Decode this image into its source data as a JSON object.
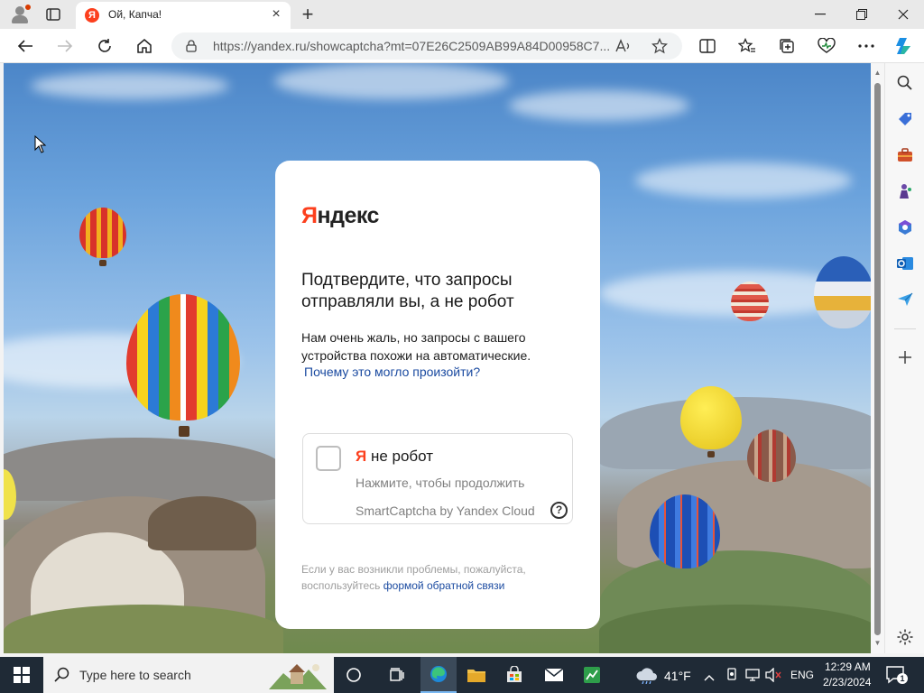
{
  "browser": {
    "tab_title": "Ой, Капча!",
    "favicon_letter": "Я",
    "url": "https://yandex.ru/showcaptcha?mt=07E26C2509AB99A84D00958C7..."
  },
  "captcha": {
    "logo_ya": "Я",
    "logo_rest": "ндекс",
    "title": "Подтвердите, что запросы отправляли вы, а не робот",
    "description": "Нам очень жаль, но запросы с вашего устройства похожи на автоматические.",
    "why_link": "Почему это могло произойти?",
    "checkbox_ya": "Я",
    "checkbox_rest": " не робот",
    "checkbox_hint": "Нажмите, чтобы продолжить",
    "brand": "SmartCaptcha by Yandex Cloud",
    "help_glyph": "?",
    "footer_text": "Если у вас возникли проблемы, пожалуйста, воспользуйтесь",
    "footer_link": "формой обратной связи"
  },
  "taskbar": {
    "search_placeholder": "Type here to search",
    "weather": "41°F",
    "language": "ENG",
    "time": "12:29 AM",
    "date": "2/23/2024",
    "notification_count": "1"
  },
  "colors": {
    "yandex_red": "#fc3f1d",
    "link_blue": "#1a4aa0",
    "taskbar": "#1f2a36"
  }
}
